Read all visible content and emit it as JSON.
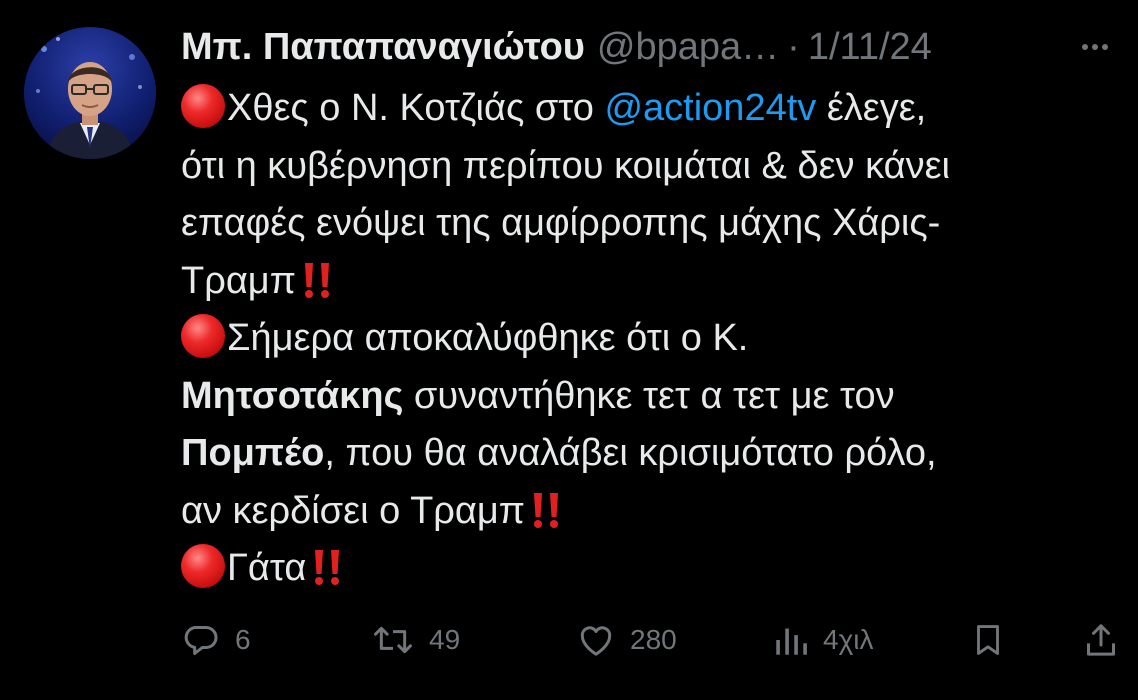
{
  "author": {
    "display_name": "Μπ. Παπαπαναγιώτου",
    "handle": "@bpapa…",
    "separator": "·",
    "date": "1/11/24"
  },
  "tweet": {
    "lines": {
      "l1_pre": "Χθες ο Ν. Κοτζιάς στο ",
      "l1_mention": "@action24tv",
      "l1_post": " έλεγε,",
      "l2": "ότι η κυβέρνηση περίπου κοιμάται & δεν κάνει",
      "l3": "επαφές ενόψει της αμφίρροπης μάχης Χάρις-",
      "l4": "Τραμπ",
      "l5": "Σήμερα αποκαλύφθηκε ότι ο Κ.",
      "l6_bold": "Μητσοτάκης",
      "l6_rest": " συναντήθηκε τετ α τετ με τον",
      "l7_bold": "Πομπέο",
      "l7_rest": ", που θα αναλάβει κρισιμότατο ρόλο,",
      "l8": "αν κερδίσει ο Τραμπ",
      "l9": "Γάτα"
    }
  },
  "actions": {
    "replies": "6",
    "reposts": "49",
    "likes": "280",
    "views": "4χιλ"
  },
  "icons": {
    "reply": "reply-icon",
    "repost": "repost-icon",
    "like": "heart-icon",
    "views": "views-icon",
    "bookmark": "bookmark-icon",
    "share": "share-icon",
    "more": "more-icon",
    "emoji_circle": "red-circle-emoji",
    "emoji_bangbang": "double-exclamation-emoji"
  },
  "colors": {
    "background": "#000000",
    "text": "#e7e9ea",
    "muted": "#71767b",
    "mention": "#1d9bf0",
    "emoji_red": "#e0211f"
  }
}
